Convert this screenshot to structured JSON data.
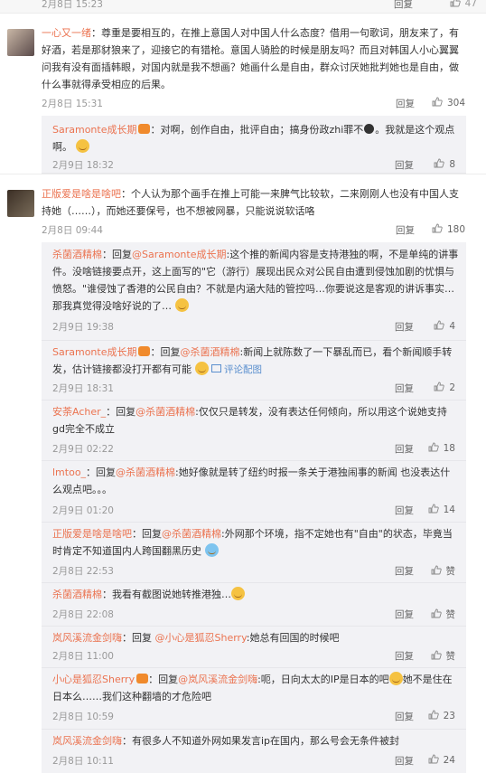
{
  "top": {
    "date": "2月8日 15:23",
    "reply": "回复",
    "likes": "47"
  },
  "comments": [
    {
      "user": "一心又一绪",
      "text": "：尊重是要相互的，在推上意国人对中国人什么态度？借用一句歌词，朋友来了，有好酒，若是那豺狼来了，迎接它的有猎枪。意国人骑脸的时候是朋友吗？而且对韩国人小心翼翼问我有没有面插韩眼，对国内就是我不想画？她画什么是自由，群众讨厌她批判她也是自由，做什么事就得承受相应的后果。",
      "date": "2月8日 15:31",
      "reply": "回复",
      "likes": "304",
      "subs": [
        {
          "user": "Saramonte成长期",
          "text": "：对啊，创作自由，批评自由；搞身份政zhi罪不",
          "text2": "。我就是这个观点",
          "text3": "啊。",
          "date": "2月9日 18:32",
          "reply": "回复",
          "likes": "8"
        }
      ]
    },
    {
      "user": "正版爱是啥是啥吧",
      "text": "：个人认为那个画手在推上可能一来脾气比较软，二来刚刚人也没有中国人支持她（……），而她还要保号，也不想被网暴，只能说说软话咯",
      "date": "2月8日 09:44",
      "reply": "回复",
      "likes": "180",
      "subs": [
        {
          "user": "杀菌酒精棉",
          "pre": "：回复",
          "at": "@Saramonte成长期",
          "text": ":这个推的新闻内容是支持港独的啊，不是单纯的讲事件。没啥链接要点开，这上面写的\"它（游行）展现出民众对公民自由遭到侵蚀加剧的忧惧与愤怒。\"谁侵蚀了香港的公民自由？不就是内涵大陆的管控吗…你要说这是客观的讲诉事实… 那我真觉得没啥好说的了…",
          "date": "2月9日 19:38",
          "reply": "回复",
          "likes": "4"
        },
        {
          "user": "Saramonte成长期",
          "pre": "：回复",
          "at": "@杀菌酒精棉",
          "text": ":新闻上就陈数了一下暴乱而已，看个新闻顺手转发，估计链接都没打开都有可能",
          "img": "评论配图",
          "date": "2月9日 18:31",
          "reply": "回复",
          "likes": "2"
        },
        {
          "user": "安荼Acher_",
          "pre": "：回复",
          "at": "@杀菌酒精棉",
          "text": ":仅仅只是转发，没有表达任何倾向，所以用这个说她支持gd完全不成立",
          "date": "2月9日 02:22",
          "reply": "回复",
          "likes": "18"
        },
        {
          "user": "lmtoo_",
          "pre": "：回复",
          "at": "@杀菌酒精棉",
          "text": ":她好像就是转了纽约时报一条关于港独闹事的新闻 也没表达什么观点吧。。。",
          "date": "2月9日 01:20",
          "reply": "回复",
          "likes": "14"
        },
        {
          "user": "正版爱是啥是啥吧",
          "pre": "：回复",
          "at": "@杀菌酒精棉",
          "text": ":外网那个环境，指不定她也有\"自由\"的状态，毕竟当时肯定不知道国内人跨国翻黑历史",
          "date": "2月8日 22:53",
          "reply": "回复",
          "likes": "赞"
        },
        {
          "user": "杀菌酒精棉",
          "pre": "：",
          "at": "",
          "text": "我看有截图说她转推港独…",
          "date": "2月8日 22:08",
          "reply": "回复",
          "likes": "赞"
        },
        {
          "user": "岚风溪流金剑嗨",
          "pre": "：回复 ",
          "at": "@小心是狐忍Sherry",
          "text": ":她总有回国的时候吧",
          "date": "2月8日 11:00",
          "reply": "回复",
          "likes": "赞"
        },
        {
          "user": "小心是狐忍Sherry",
          "pre": "：回复",
          "at": "@岚风溪流金剑嗨",
          "text": ":呃，日向太太的IP是日本的吧",
          "text2": "她不是住在日本么……我们这种翻墙的才危险吧",
          "date": "2月8日 10:59",
          "reply": "回复",
          "likes": "23"
        },
        {
          "user": "岚风溪流金剑嗨",
          "pre": "：",
          "at": "",
          "text": "有很多人不知道外网如果发言ip在国内，那么号会无条件被封",
          "date": "2月8日 10:11",
          "reply": "回复",
          "likes": "24"
        }
      ]
    }
  ]
}
